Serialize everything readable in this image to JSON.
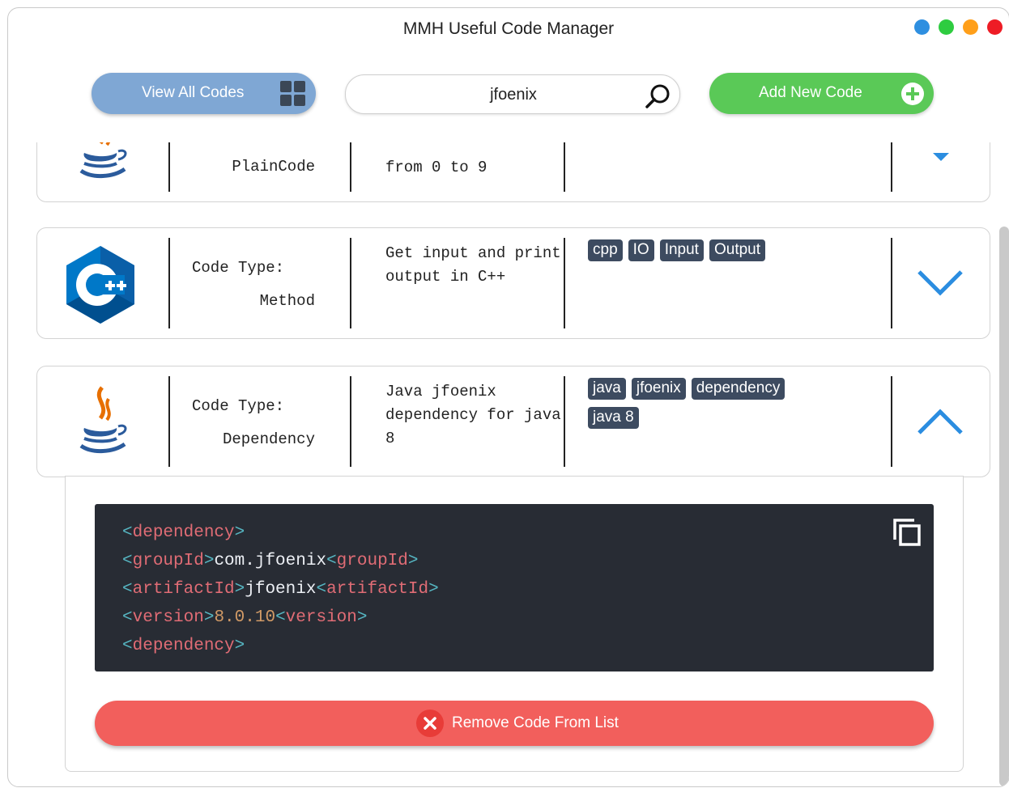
{
  "app": {
    "title": "MMH Useful Code Manager"
  },
  "window_controls": {
    "colors": [
      "#2e8fe0",
      "#2ecc40",
      "#ff9f1a",
      "#ee1c25"
    ]
  },
  "toolbar": {
    "view_all_label": "View All Codes",
    "view_all_color": "#7fa7d4",
    "add_label": "Add New Code",
    "add_color": "#5ac957"
  },
  "search": {
    "value": "jfoenix",
    "placeholder": ""
  },
  "cards": [
    {
      "type_label": "",
      "type_value": "PlainCode",
      "description": "from 0 to 9",
      "tags": [],
      "icon": "java-icon",
      "expanded": false
    },
    {
      "type_label": "Code Type:",
      "type_value": "Method",
      "description": "Get input and print output in C++",
      "tags": [
        "cpp",
        "IO",
        "Input",
        "Output"
      ],
      "icon": "cpp-icon",
      "expanded": false
    },
    {
      "type_label": "Code Type:",
      "type_value": "Dependency",
      "description": "Java jfoenix dependency for java 8",
      "tags": [
        "java",
        "jfoenix",
        "dependency",
        "java 8"
      ],
      "icon": "java-icon",
      "expanded": true
    }
  ],
  "code_panel": {
    "lines": [
      "<dependency>",
      "<groupId>com.jfoenix<groupId>",
      "<artifactId>jfoenix<artifactId>",
      "<version>8.0.10<version>",
      "<dependency>"
    ],
    "tag_color": "#e06c75",
    "bracket_color": "#56b6c2",
    "number_color": "#d19a66",
    "background": "#282c34"
  },
  "remove_label": "Remove Code From List",
  "remove_color": "#f25f5c",
  "tag_color": "#3d4b60"
}
